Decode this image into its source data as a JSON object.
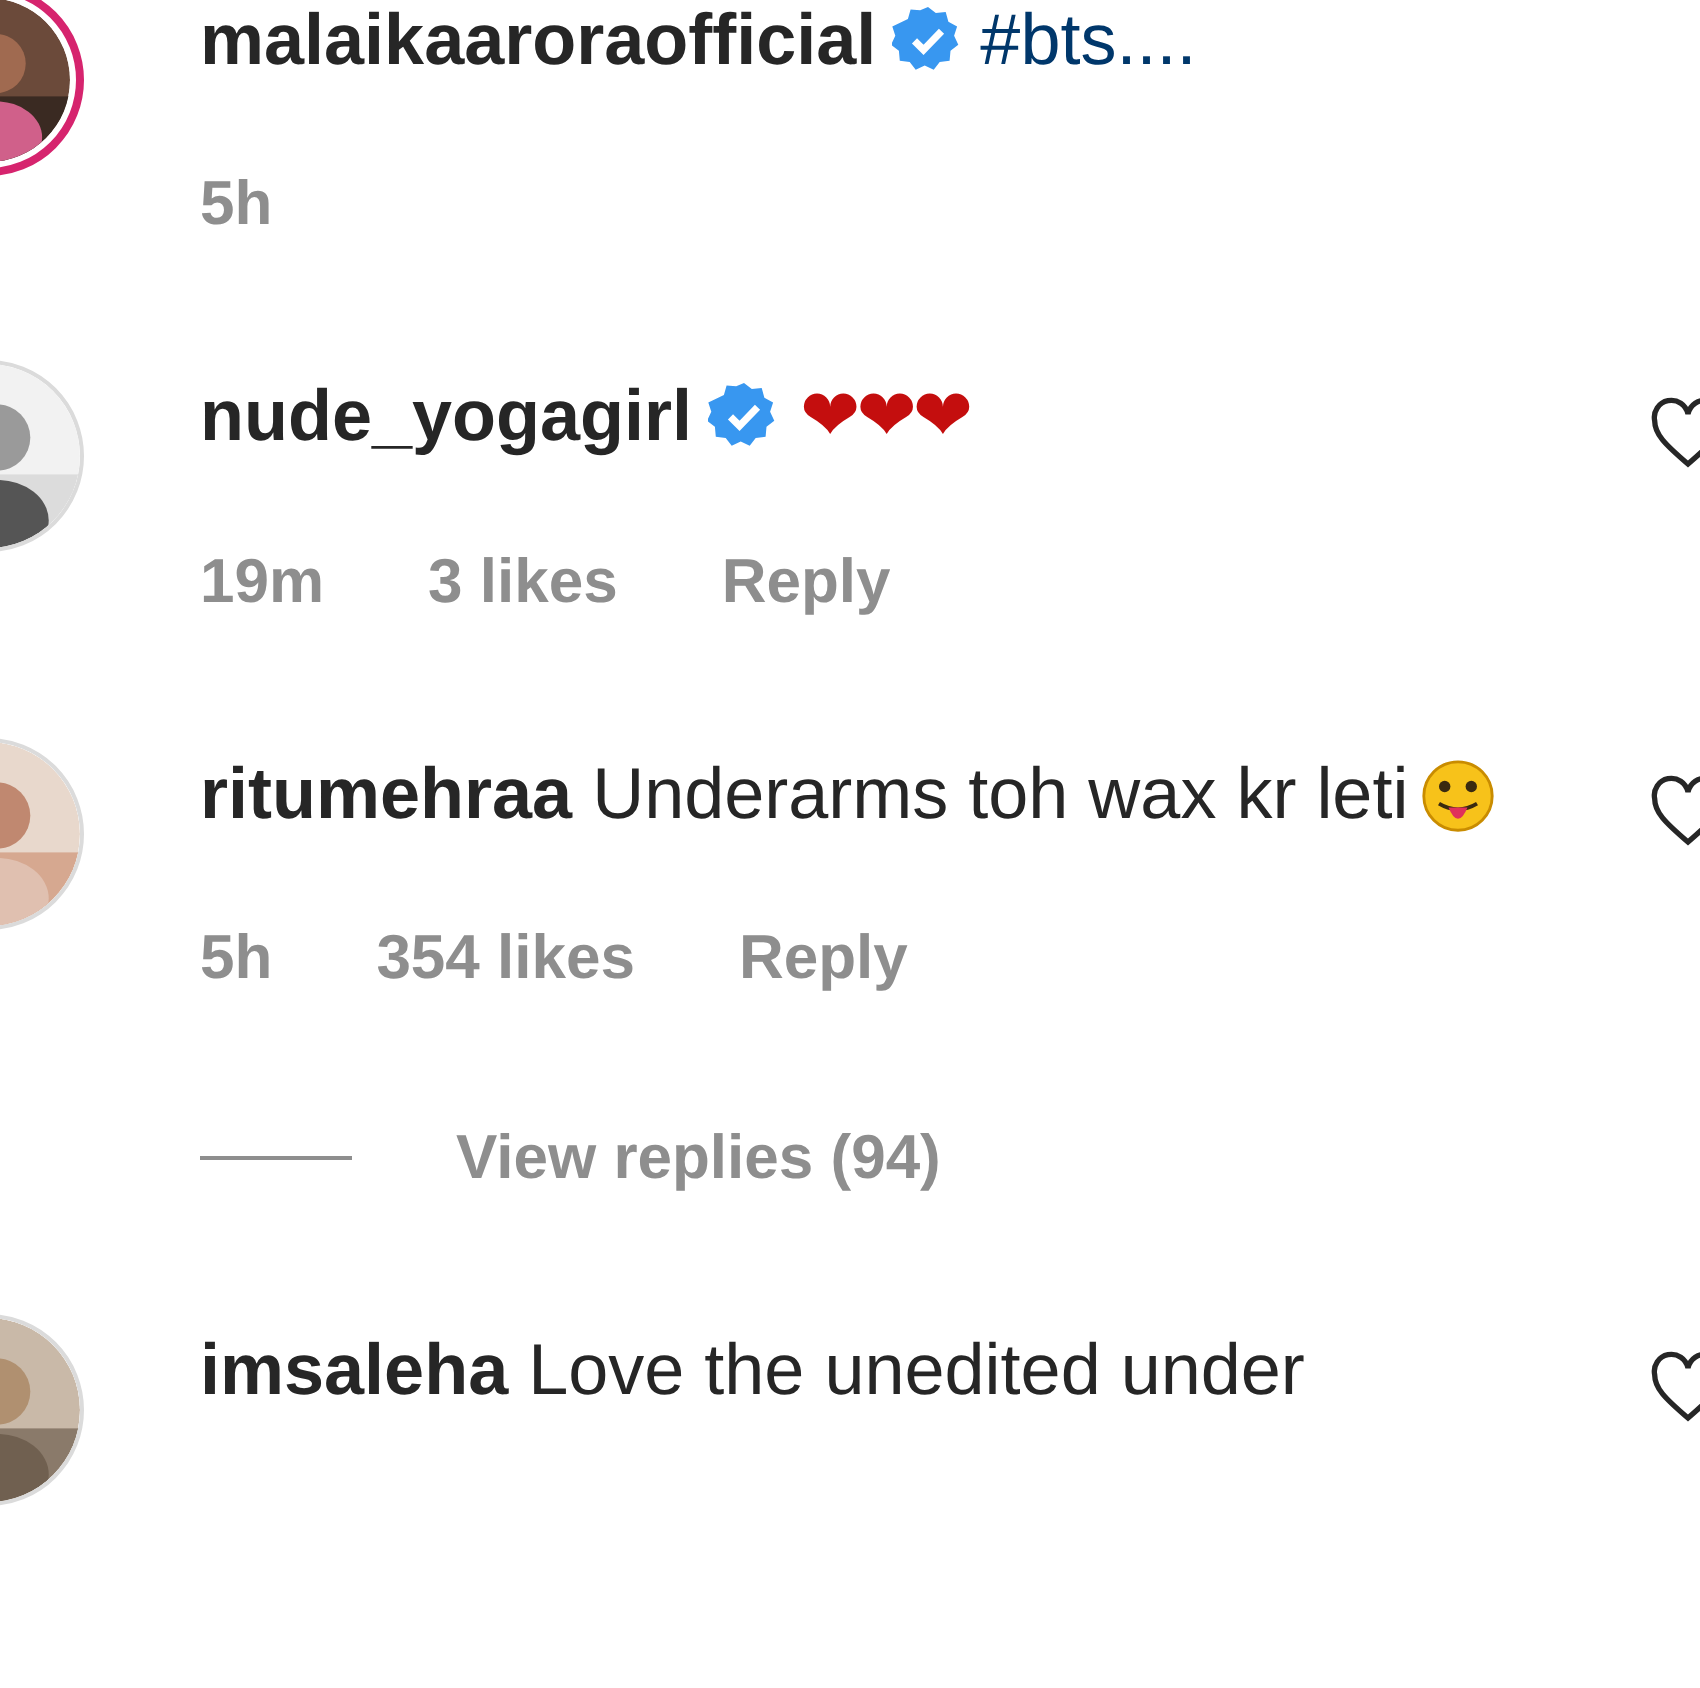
{
  "comments": [
    {
      "username": "malaikaaroraofficial",
      "verified": true,
      "story_ring": true,
      "parts": [
        {
          "kind": "hashtag",
          "text": "#bts...."
        }
      ],
      "time": "5h",
      "like_button": false
    },
    {
      "username": "nude_yogagirl",
      "verified": true,
      "story_ring": false,
      "parts": [
        {
          "kind": "hearts",
          "text": "❤❤❤"
        }
      ],
      "time": "19m",
      "likes": "3 likes",
      "reply": "Reply",
      "like_button": true
    },
    {
      "username": "ritumehraa",
      "verified": false,
      "story_ring": false,
      "parts": [
        {
          "kind": "text",
          "text": "Underarms toh wax kr leti"
        },
        {
          "kind": "emoji"
        }
      ],
      "time": "5h",
      "likes": "354 likes",
      "reply": "Reply",
      "view_replies": "View replies (94)",
      "like_button": true
    },
    {
      "username": "imsaleha",
      "verified": false,
      "story_ring": false,
      "parts": [
        {
          "kind": "text",
          "text": "Love the unedited under"
        }
      ],
      "like_button": true
    }
  ]
}
